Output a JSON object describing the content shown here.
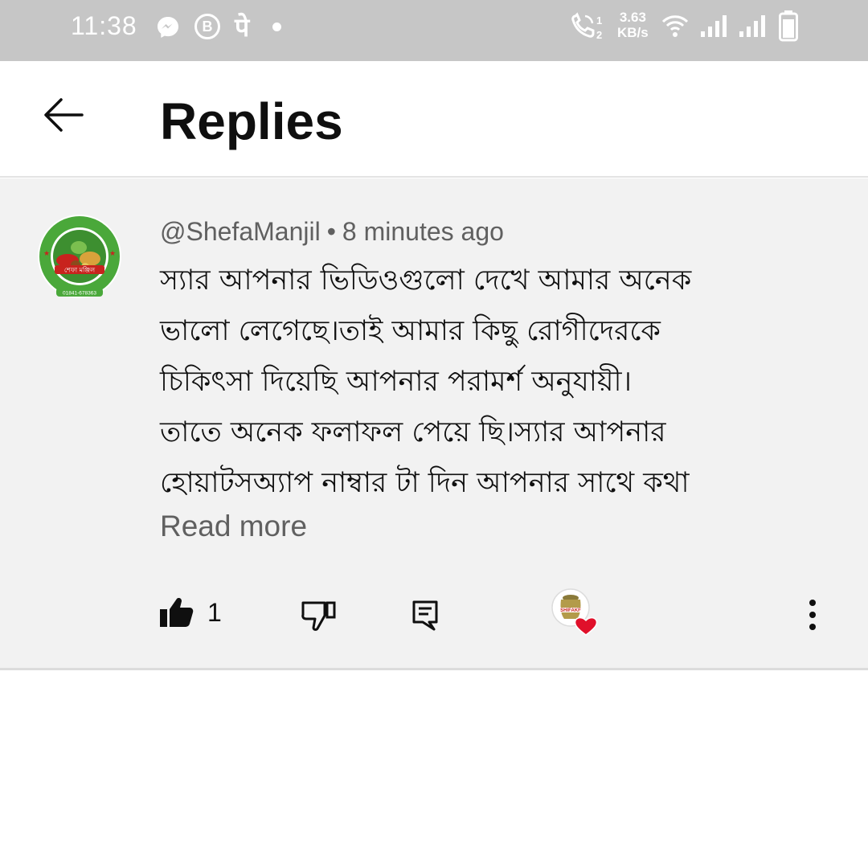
{
  "status_bar": {
    "time": "11:38",
    "speed_value": "3.63",
    "speed_unit": "KB/s",
    "call_sim_1": "1",
    "call_sim_2": "2",
    "pe_glyph": "पे",
    "b_glyph": "B",
    "icons": [
      "messenger-icon",
      "b-circle-icon",
      "phonepe-icon",
      "notification-dot-icon",
      "volte-call-icon",
      "wifi-icon",
      "signal-icon",
      "signal-icon",
      "battery-icon"
    ]
  },
  "header": {
    "title": "Replies",
    "back_icon": "arrow-left-icon"
  },
  "comment": {
    "author": "@ShefaManjil",
    "separator": "•",
    "time_ago": "8 minutes ago",
    "lines": [
      "স্যার আপনার ভিডিওগুলো দেখে আমার অনেক",
      "ভালো লেগেছে।তাই আমার কিছু রোগীদেরকে",
      "চিকিৎসা দিয়েছি আপনার পরামর্শ অনুযায়ী।",
      "তাতে অনেক ফলাফল পেয়ে ছি।স্যার আপনার",
      "হোয়াটসঅ্যাপ নাম্বার টা দিন আপনার সাথে কথা"
    ],
    "read_more": "Read more",
    "like_count": "1",
    "avatar_logo_text": "শেফা মঞ্জিল",
    "avatar_phone": "01841-678363",
    "creator_logo_text": "SHIFAKF"
  },
  "colors": {
    "status_bar_bg": "#c6c6c6",
    "card_bg": "#f2f2f2",
    "secondary_text": "#606060",
    "heart": "#e0102a",
    "avatar_green": "#4aa83a"
  }
}
